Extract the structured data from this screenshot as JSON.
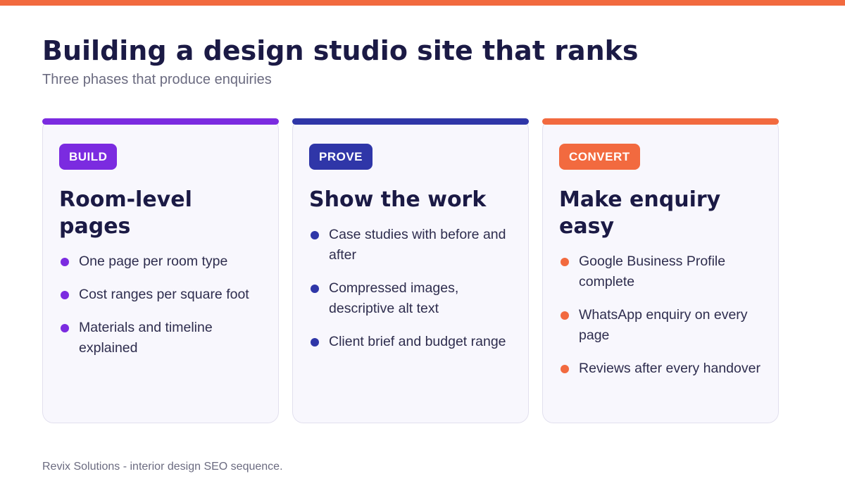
{
  "page": {
    "title": "Building a design studio site that ranks",
    "subtitle": "Three phases that produce enquiries",
    "footer": "Revix Solutions - interior design SEO sequence."
  },
  "colors": {
    "top_bar": "#f26a3f",
    "build": "#7b2be0",
    "prove": "#2f36a8",
    "convert": "#f26a3f"
  },
  "cards": [
    {
      "badge": "BUILD",
      "title": "Room-level pages",
      "bullets": [
        "One page per room type",
        "Cost ranges per square foot",
        "Materials and timeline explained"
      ]
    },
    {
      "badge": "PROVE",
      "title": "Show the work",
      "bullets": [
        "Case studies with before and after",
        "Compressed images, descriptive alt text",
        "Client brief and budget range"
      ]
    },
    {
      "badge": "CONVERT",
      "title": "Make enquiry easy",
      "bullets": [
        "Google Business Profile complete",
        "WhatsApp enquiry on every page",
        "Reviews after every handover"
      ]
    }
  ]
}
